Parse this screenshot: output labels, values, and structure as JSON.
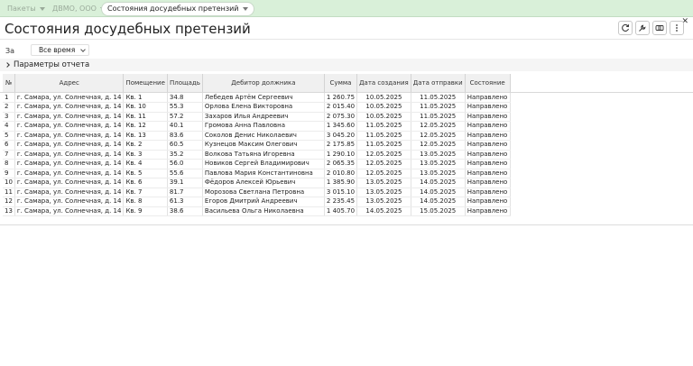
{
  "tabs": [
    {
      "label": "Пакеты",
      "active": false
    },
    {
      "label": "ДВМО, ООО",
      "active": false
    },
    {
      "label": "Состояния досудебных претензий",
      "active": true
    }
  ],
  "page": {
    "title": "Состояния досудебных претензий"
  },
  "filter": {
    "label": "За",
    "period": "Все время"
  },
  "params": {
    "label": "Параметры отчета"
  },
  "toolbar": {
    "icons": [
      "refresh-icon",
      "wrench-icon",
      "copy-icon",
      "more-icon"
    ]
  },
  "table": {
    "columns": [
      "№",
      "Адрес",
      "Помещение",
      "Площадь",
      "Дебитор должника",
      "Сумма",
      "Дата создания",
      "Дата отправки",
      "Состояние"
    ],
    "rows": [
      [
        "1",
        "г. Самара, ул. Солнечная, д. 14",
        "Кв. 1",
        "34.8",
        "Лебедев Артём Сергеевич",
        "1 260.75",
        "10.05.2025",
        "11.05.2025",
        "Направлено"
      ],
      [
        "2",
        "г. Самара, ул. Солнечная, д. 14",
        "Кв. 10",
        "55.3",
        "Орлова Елена Викторовна",
        "2 015.40",
        "10.05.2025",
        "11.05.2025",
        "Направлено"
      ],
      [
        "3",
        "г. Самара, ул. Солнечная, д. 14",
        "Кв. 11",
        "57.2",
        "Захаров Илья Андреевич",
        "2 075.30",
        "10.05.2025",
        "11.05.2025",
        "Направлено"
      ],
      [
        "4",
        "г. Самара, ул. Солнечная, д. 14",
        "Кв. 12",
        "40.1",
        "Громова Анна Павловна",
        "1 345.60",
        "11.05.2025",
        "12.05.2025",
        "Направлено"
      ],
      [
        "5",
        "г. Самара, ул. Солнечная, д. 14",
        "Кв. 13",
        "83.6",
        "Соколов Денис Николаевич",
        "3 045.20",
        "11.05.2025",
        "12.05.2025",
        "Направлено"
      ],
      [
        "6",
        "г. Самара, ул. Солнечная, д. 14",
        "Кв. 2",
        "60.5",
        "Кузнецов Максим Олегович",
        "2 175.85",
        "11.05.2025",
        "12.05.2025",
        "Направлено"
      ],
      [
        "7",
        "г. Самара, ул. Солнечная, д. 14",
        "Кв. 3",
        "35.2",
        "Волкова Татьяна Игоревна",
        "1 290.10",
        "12.05.2025",
        "13.05.2025",
        "Направлено"
      ],
      [
        "8",
        "г. Самара, ул. Солнечная, д. 14",
        "Кв. 4",
        "56.0",
        "Новиков Сергей Владимирович",
        "2 065.35",
        "12.05.2025",
        "13.05.2025",
        "Направлено"
      ],
      [
        "9",
        "г. Самара, ул. Солнечная, д. 14",
        "Кв. 5",
        "55.6",
        "Павлова Мария Константиновна",
        "2 010.80",
        "12.05.2025",
        "13.05.2025",
        "Направлено"
      ],
      [
        "10",
        "г. Самара, ул. Солнечная, д. 14",
        "Кв. 6",
        "39.1",
        "Фёдоров Алексей Юрьевич",
        "1 385.90",
        "13.05.2025",
        "14.05.2025",
        "Направлено"
      ],
      [
        "11",
        "г. Самара, ул. Солнечная, д. 14",
        "Кв. 7",
        "81.7",
        "Морозова Светлана Петровна",
        "3 015.10",
        "13.05.2025",
        "14.05.2025",
        "Направлено"
      ],
      [
        "12",
        "г. Самара, ул. Солнечная, д. 14",
        "Кв. 8",
        "61.3",
        "Егоров Дмитрий Андреевич",
        "2 235.45",
        "13.05.2025",
        "14.05.2025",
        "Направлено"
      ],
      [
        "13",
        "г. Самара, ул. Солнечная, д. 14",
        "Кв. 9",
        "38.6",
        "Васильева Ольга Николаевна",
        "1 405.70",
        "14.05.2025",
        "15.05.2025",
        "Направлено"
      ]
    ]
  }
}
